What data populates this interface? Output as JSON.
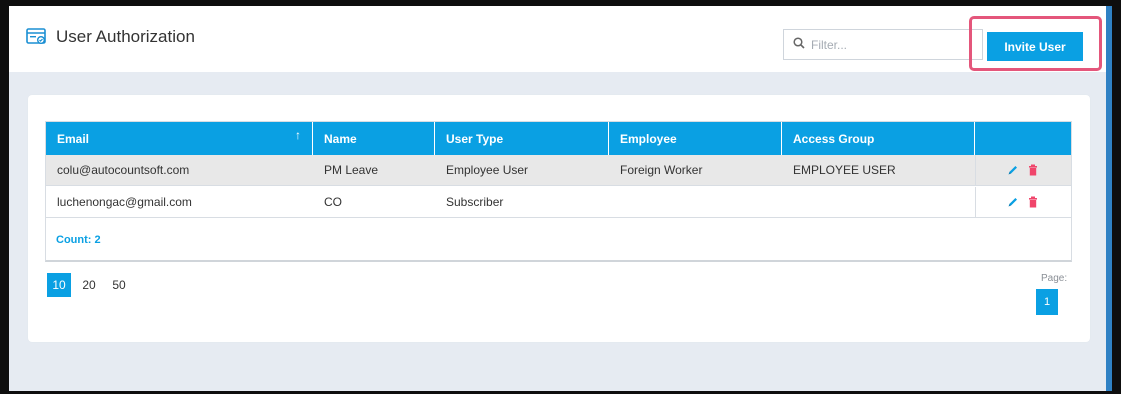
{
  "header": {
    "title": "User Authorization",
    "title_icon": "user-authorization-icon"
  },
  "toolbar": {
    "filter_placeholder": "Filter...",
    "filter_icon": "search-icon",
    "invite_label": "Invite User"
  },
  "table": {
    "columns": [
      "Email",
      "Name",
      "User Type",
      "Employee",
      "Access Group",
      ""
    ],
    "sort_column": "Email",
    "sort_direction": "ascending",
    "rows": [
      {
        "email": "colu@autocountsoft.com",
        "name": "PM Leave",
        "user_type": "Employee User",
        "employee": "Foreign Worker",
        "access_group": "EMPLOYEE USER"
      },
      {
        "email": "luchenongac@gmail.com",
        "name": "CO",
        "user_type": "Subscriber",
        "employee": "",
        "access_group": ""
      }
    ],
    "count_label": "Count: 2"
  },
  "pagination": {
    "page_sizes": [
      "10",
      "20",
      "50"
    ],
    "active_page_size": "10",
    "page_label": "Page:",
    "current_page": "1"
  },
  "colors": {
    "accent": "#0aa0e3",
    "highlight": "#e4567b",
    "edit_icon": "#0aa0e3",
    "delete_icon": "#f0456b"
  }
}
